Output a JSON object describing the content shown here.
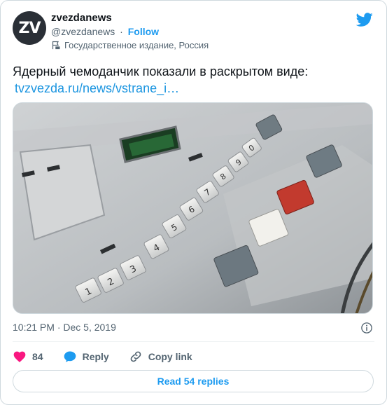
{
  "author": {
    "avatar_text": "ZV",
    "name": "zvezdanews",
    "handle": "@zvezdanews",
    "separator": "·",
    "follow_label": "Follow",
    "affiliation_label": "Государственное издание, Россия"
  },
  "tweet": {
    "text": "Ядерный чемоданчик показали в раскрытом виде:",
    "link": "tvzvezda.ru/news/vstrane_i…",
    "media_description": "Пульт с пронумерованными кнопками",
    "keypad_labels": [
      "1",
      "2",
      "3",
      "4",
      "5",
      "6",
      "7",
      "8",
      "9",
      "0"
    ],
    "timestamp": "10:21 PM · Dec 5, 2019"
  },
  "actions": {
    "like_count": "84",
    "reply_label": "Reply",
    "copy_link_label": "Copy link"
  },
  "footer": {
    "read_replies_label": "Read 54 replies"
  },
  "colors": {
    "accent": "#1d9bf0",
    "like": "#f91880",
    "muted": "#536471"
  }
}
